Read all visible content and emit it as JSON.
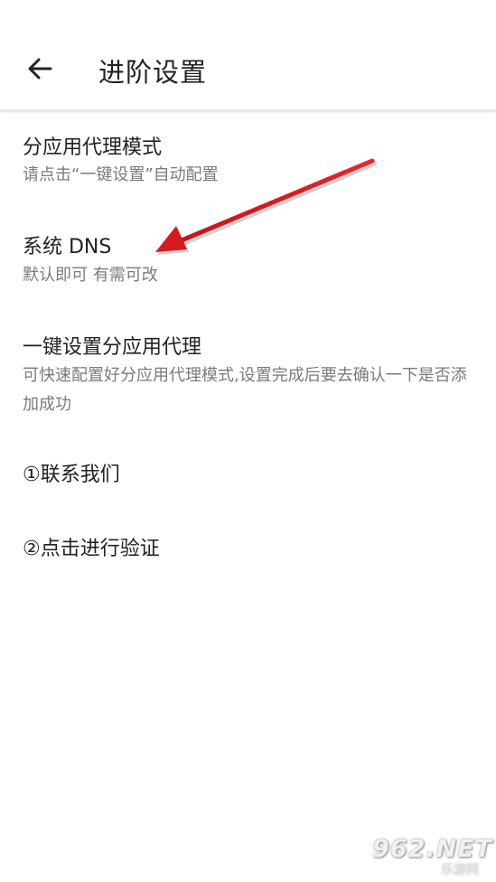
{
  "header": {
    "title": "进阶设置",
    "back_icon": "arrow-left-icon"
  },
  "settings": [
    {
      "title": "分应用代理模式",
      "subtitle": "请点击“一键设置”自动配置"
    },
    {
      "title": "系统 DNS",
      "subtitle": "默认即可 有需可改"
    },
    {
      "title": "一键设置分应用代理",
      "subtitle": "可快速配置好分应用代理模式,设置完成后要去确认一下是否添加成功"
    },
    {
      "title": "①联系我们"
    },
    {
      "title": "②点击进行验证"
    }
  ],
  "annotation": {
    "arrow_color": "#d9191c",
    "arrow_icon": "red-arrow-icon"
  },
  "watermark": {
    "main": "962.NET",
    "sub": "乐游网"
  },
  "colors": {
    "background": "#ffffff",
    "title_text": "#212121",
    "subtitle_text": "#7a7a7a"
  }
}
